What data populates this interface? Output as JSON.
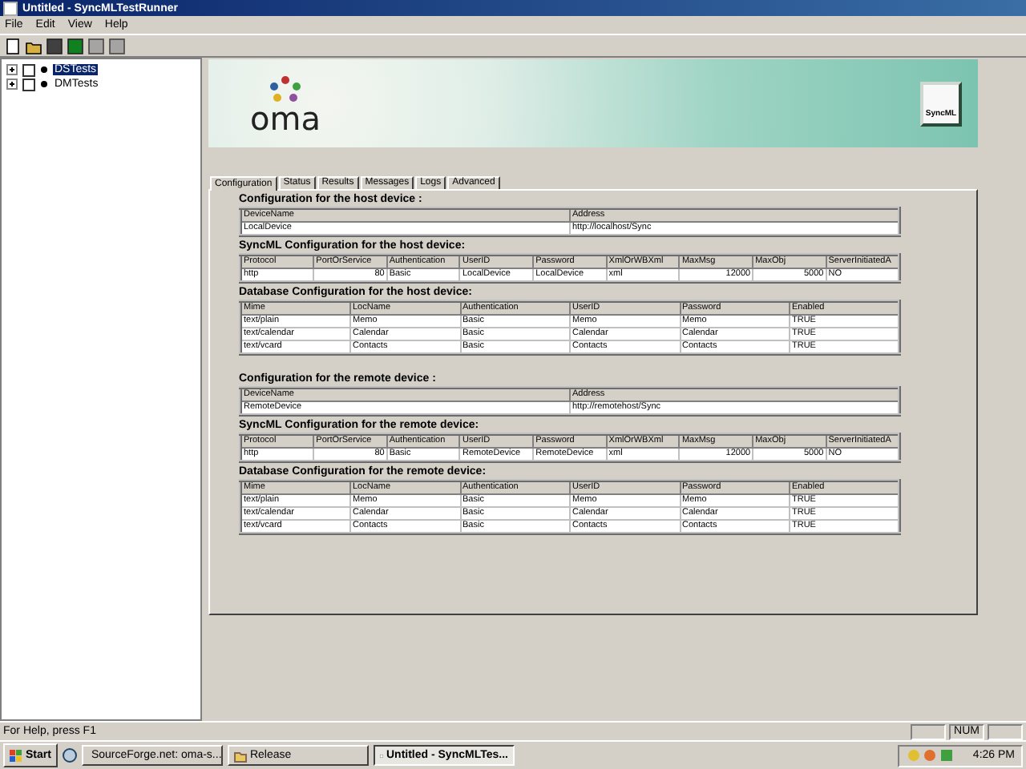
{
  "window": {
    "title": "Untitled - SyncMLTestRunner"
  },
  "menu": [
    "File",
    "Edit",
    "View",
    "Help"
  ],
  "toolbar": [
    {
      "kind": "new"
    },
    {
      "kind": "open"
    },
    {
      "kind": "save"
    },
    {
      "kind": "run",
      "disabled": false
    },
    {
      "kind": "step",
      "disabled": true
    },
    {
      "kind": "stop",
      "disabled": true
    }
  ],
  "tree": [
    {
      "label": "DSTests",
      "selected": true,
      "checked": false,
      "expanded": false
    },
    {
      "label": "DMTests",
      "selected": false,
      "checked": false,
      "expanded": false
    }
  ],
  "banner": {
    "logo": "oma",
    "badge": "SyncML"
  },
  "tabs": [
    {
      "label": "Configuration",
      "selected": true
    },
    {
      "label": "Status",
      "selected": false
    },
    {
      "label": "Results",
      "selected": false
    },
    {
      "label": "Messages",
      "selected": false
    },
    {
      "label": "Logs",
      "selected": false
    },
    {
      "label": "Advanced",
      "selected": false
    }
  ],
  "groups": [
    {
      "sections": [
        {
          "title": "Configuration for the host device :",
          "columns": [
            {
              "label": "DeviceName"
            },
            {
              "label": "Address"
            }
          ],
          "rows": [
            [
              "LocalDevice",
              "http://localhost/Sync"
            ]
          ]
        },
        {
          "title": "SyncML Configuration for the host device:",
          "columns": [
            {
              "label": "Protocol"
            },
            {
              "label": "PortOrService",
              "numeric": true
            },
            {
              "label": "Authentication"
            },
            {
              "label": "UserID"
            },
            {
              "label": "Password"
            },
            {
              "label": "XmlOrWBXml"
            },
            {
              "label": "MaxMsg",
              "numeric": true
            },
            {
              "label": "MaxObj",
              "numeric": true
            },
            {
              "label": "ServerInitiatedA"
            }
          ],
          "rows": [
            [
              "http",
              "80",
              "Basic",
              "LocalDevice",
              "LocalDevice",
              "xml",
              "12000",
              "5000",
              "NO"
            ]
          ]
        },
        {
          "title": "Database Configuration for the host device:",
          "columns": [
            {
              "label": "Mime"
            },
            {
              "label": "LocName"
            },
            {
              "label": "Authentication"
            },
            {
              "label": "UserID"
            },
            {
              "label": "Password"
            },
            {
              "label": "Enabled"
            }
          ],
          "rows": [
            [
              "text/plain",
              "Memo",
              "Basic",
              "Memo",
              "Memo",
              "TRUE"
            ],
            [
              "text/calendar",
              "Calendar",
              "Basic",
              "Calendar",
              "Calendar",
              "TRUE"
            ],
            [
              "text/vcard",
              "Contacts",
              "Basic",
              "Contacts",
              "Contacts",
              "TRUE"
            ]
          ]
        }
      ]
    },
    {
      "sections": [
        {
          "title": "Configuration for the remote device :",
          "columns": [
            {
              "label": "DeviceName"
            },
            {
              "label": "Address"
            }
          ],
          "rows": [
            [
              "RemoteDevice",
              "http://remotehost/Sync"
            ]
          ]
        },
        {
          "title": "SyncML Configuration for the remote device:",
          "columns": [
            {
              "label": "Protocol"
            },
            {
              "label": "PortOrService",
              "numeric": true
            },
            {
              "label": "Authentication"
            },
            {
              "label": "UserID"
            },
            {
              "label": "Password"
            },
            {
              "label": "XmlOrWBXml"
            },
            {
              "label": "MaxMsg",
              "numeric": true
            },
            {
              "label": "MaxObj",
              "numeric": true
            },
            {
              "label": "ServerInitiatedA"
            }
          ],
          "rows": [
            [
              "http",
              "80",
              "Basic",
              "RemoteDevice",
              "RemoteDevice",
              "xml",
              "12000",
              "5000",
              "NO"
            ]
          ]
        },
        {
          "title": "Database Configuration for the remote device:",
          "columns": [
            {
              "label": "Mime"
            },
            {
              "label": "LocName"
            },
            {
              "label": "Authentication"
            },
            {
              "label": "UserID"
            },
            {
              "label": "Password"
            },
            {
              "label": "Enabled"
            }
          ],
          "rows": [
            [
              "text/plain",
              "Memo",
              "Basic",
              "Memo",
              "Memo",
              "TRUE"
            ],
            [
              "text/calendar",
              "Calendar",
              "Basic",
              "Calendar",
              "Calendar",
              "TRUE"
            ],
            [
              "text/vcard",
              "Contacts",
              "Basic",
              "Contacts",
              "Contacts",
              "TRUE"
            ]
          ]
        }
      ]
    }
  ],
  "status_bar": {
    "text": "For Help, press F1",
    "indicators": [
      "NUM"
    ]
  },
  "taskbar": {
    "start": "Start",
    "tasks": [
      {
        "label": "SourceForge.net: oma-s...",
        "kind": "browser",
        "selected": false
      },
      {
        "label": "Release",
        "kind": "folder",
        "selected": false
      },
      {
        "label": "Untitled - SyncMLTes...",
        "kind": "app",
        "selected": true
      }
    ],
    "clock": "4:26 PM"
  }
}
